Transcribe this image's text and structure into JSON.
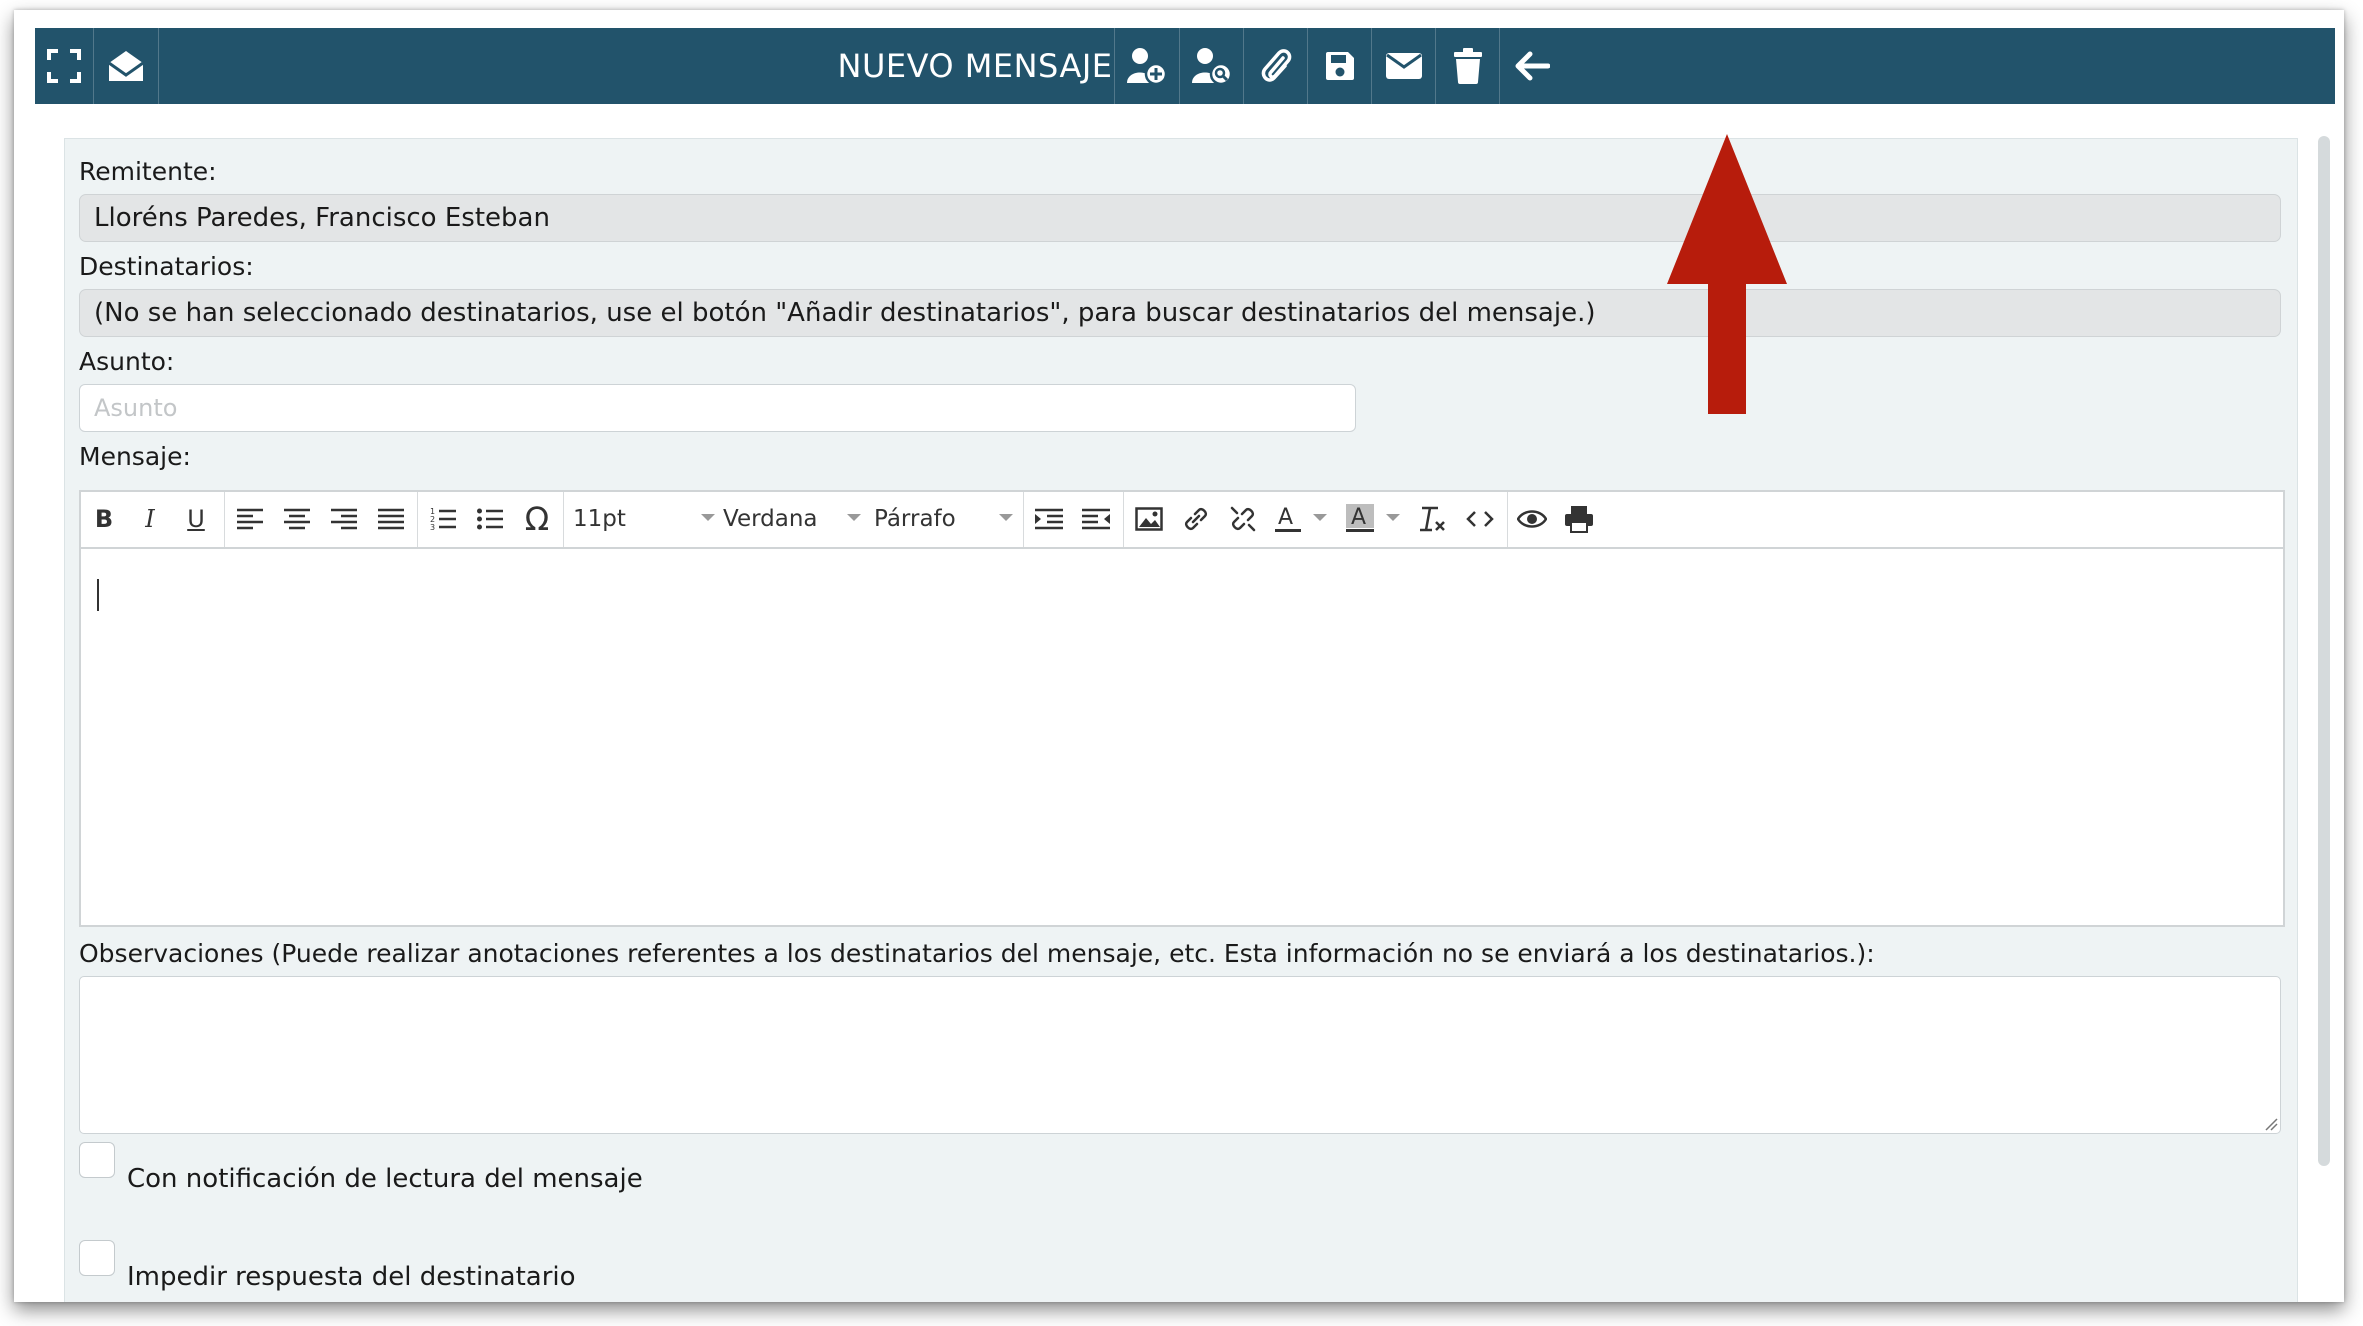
{
  "header": {
    "title": "NUEVO MENSAJE",
    "bar_color": "#22536b",
    "icons": [
      "expand-icon",
      "open-envelope-icon",
      "add-user-icon",
      "search-user-icon",
      "paperclip-icon",
      "save-icon",
      "envelope-icon",
      "trash-icon",
      "back-arrow-icon"
    ]
  },
  "form": {
    "sender_label": "Remitente:",
    "sender_value": "Lloréns Paredes, Francisco Esteban",
    "recipients_label": "Destinatarios:",
    "recipients_value": "(No se han seleccionado destinatarios, use el botón \"Añadir destinatarios\", para buscar destinatarios del mensaje.)",
    "subject_label": "Asunto:",
    "subject_placeholder": "Asunto",
    "subject_value": "",
    "message_label": "Mensaje:",
    "notes_label": "Observaciones (Puede realizar anotaciones referentes a los destinatarios del mensaje, etc. Esta información no se enviará a los destinatarios.):",
    "notes_value": ""
  },
  "editor": {
    "font_size": "11pt",
    "font_family": "Verdana",
    "block_format": "Párrafo",
    "bold": "B",
    "italic": "I",
    "underline": "U",
    "omega": "Ω",
    "tools": [
      "bold-button",
      "italic-button",
      "underline-button",
      "align-left-button",
      "align-center-button",
      "align-right-button",
      "justify-button",
      "numbered-list-button",
      "bullet-list-button",
      "special-char-button",
      "indent-button",
      "outdent-button",
      "image-button",
      "link-button",
      "unlink-button",
      "text-color-button",
      "background-color-button",
      "clear-format-button",
      "source-code-button",
      "preview-button",
      "print-button"
    ]
  },
  "options": {
    "read_receipt_label": "Con notificación de lectura del mensaje",
    "read_receipt_checked": false,
    "block_reply_label": "Impedir respuesta del destinatario",
    "block_reply_checked": false
  },
  "annotation": {
    "arrow_color": "#b71c0c",
    "points_to": "add-user-icon"
  }
}
